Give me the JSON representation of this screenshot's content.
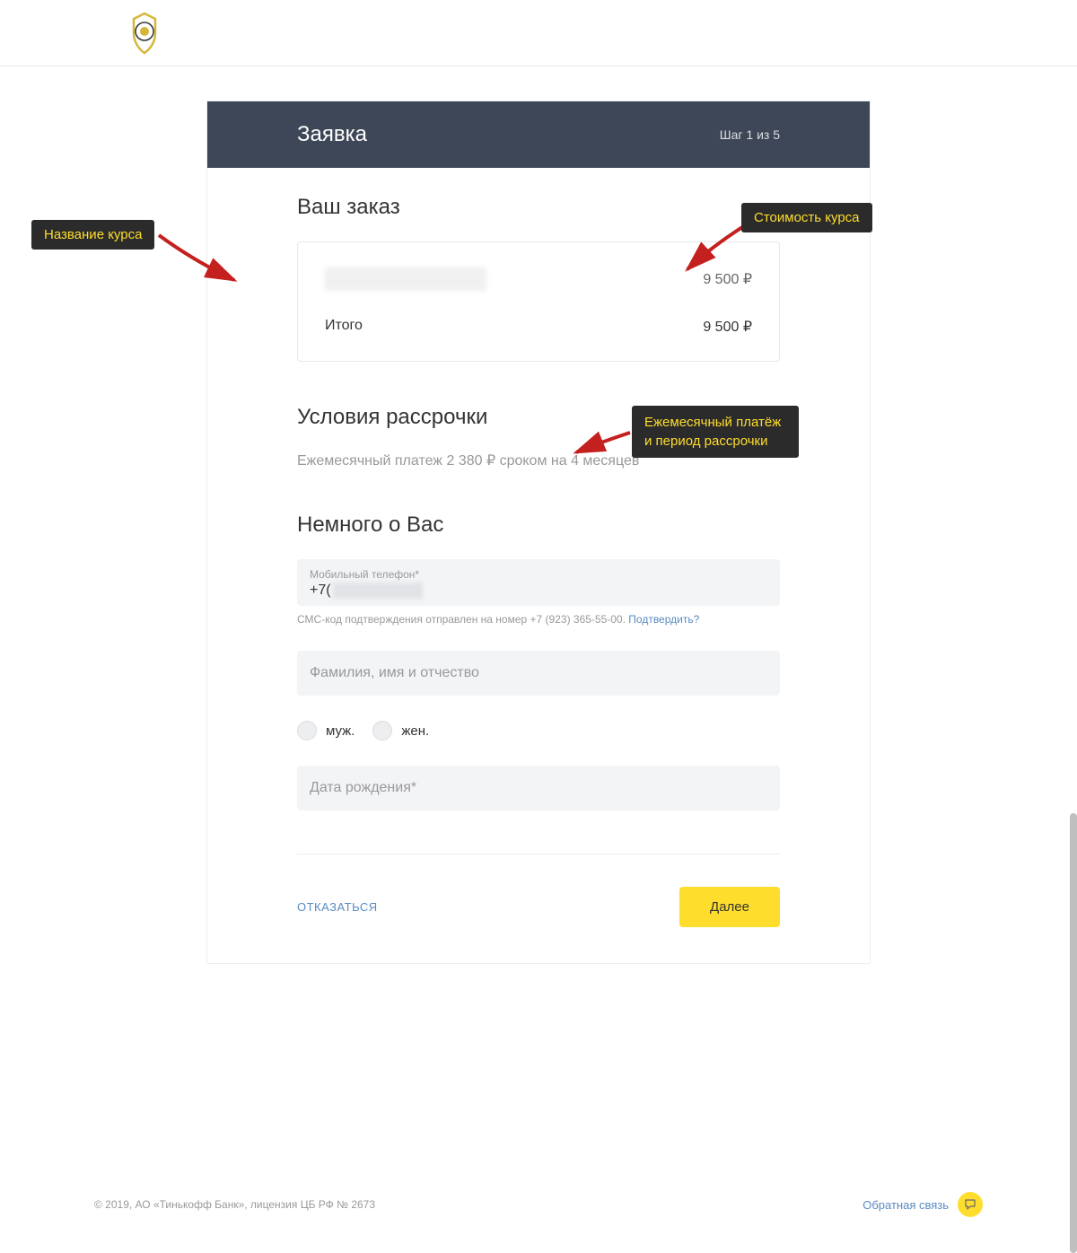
{
  "header": {
    "card_title": "Заявка",
    "step_indicator": "Шаг 1 из 5"
  },
  "order": {
    "section_title": "Ваш заказ",
    "item_price": "9 500 ₽",
    "total_label": "Итого",
    "total_value": "9 500 ₽"
  },
  "installment": {
    "section_title": "Условия рассрочки",
    "text": "Ежемесячный платеж 2 380 ₽ сроком на 4 месяцев"
  },
  "about": {
    "section_title": "Немного о Вас",
    "phone_label": "Мобильный телефон*",
    "phone_prefix": "+7(",
    "sms_hint_text": "СМС-код подтверждения отправлен на номер +7 (923) 365-55-00. ",
    "sms_confirm_link": "Подтвердить?",
    "fio_placeholder": "Фамилия, имя и отчество",
    "gender_male": "муж.",
    "gender_female": "жен.",
    "dob_placeholder": "Дата рождения*"
  },
  "actions": {
    "decline": "ОТКАЗАТЬСЯ",
    "next": "Далее"
  },
  "footer": {
    "copyright": "© 2019, АО «Тинькофф Банк», лицензия ЦБ РФ № 2673",
    "feedback": "Обратная связь"
  },
  "annotations": {
    "course_name": "Название курса",
    "course_price": "Стоимость курса",
    "monthly_payment": "Ежемесячный платёж и период рассрочки"
  }
}
